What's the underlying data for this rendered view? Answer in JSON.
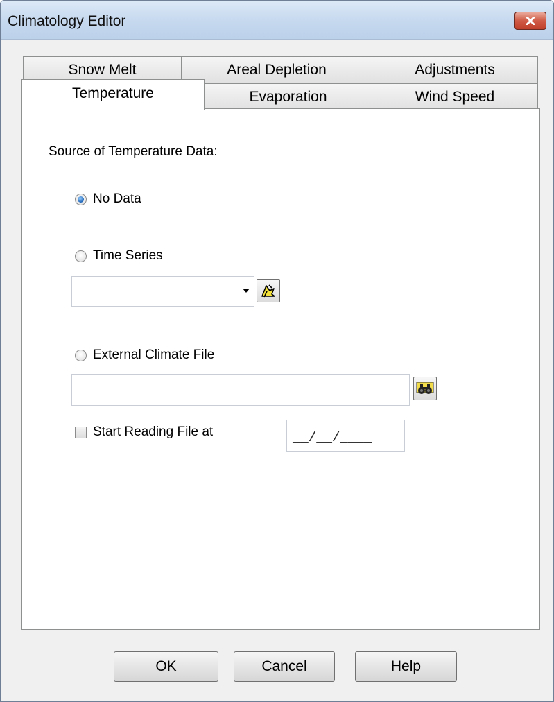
{
  "window": {
    "title": "Climatology Editor",
    "close_icon": "close-icon"
  },
  "tabs": {
    "row_back": [
      {
        "label": "Snow Melt"
      },
      {
        "label": "Areal Depletion"
      },
      {
        "label": "Adjustments"
      }
    ],
    "row_front": [
      {
        "label": "Temperature",
        "active": true
      },
      {
        "label": "Evaporation"
      },
      {
        "label": "Wind Speed"
      }
    ]
  },
  "panel": {
    "source_label": "Source of Temperature Data:",
    "options": {
      "no_data": {
        "label": "No Data",
        "selected": true
      },
      "time_series": {
        "label": "Time Series",
        "selected": false,
        "dropdown_value": "",
        "edit_icon": "edit-icon"
      },
      "external_file": {
        "label": "External Climate File",
        "selected": false,
        "path_value": "",
        "browse_icon": "binoculars-icon"
      }
    },
    "start_reading": {
      "label": "Start Reading File at",
      "checked": false,
      "date_value": "__/__/____"
    }
  },
  "buttons": {
    "ok": "OK",
    "cancel": "Cancel",
    "help": "Help"
  },
  "colors": {
    "titlebar": "#c5d8ee",
    "close_button": "#c9503c",
    "radio_selected": "#1e63b6",
    "dialog_bg": "#f0f0f0"
  }
}
